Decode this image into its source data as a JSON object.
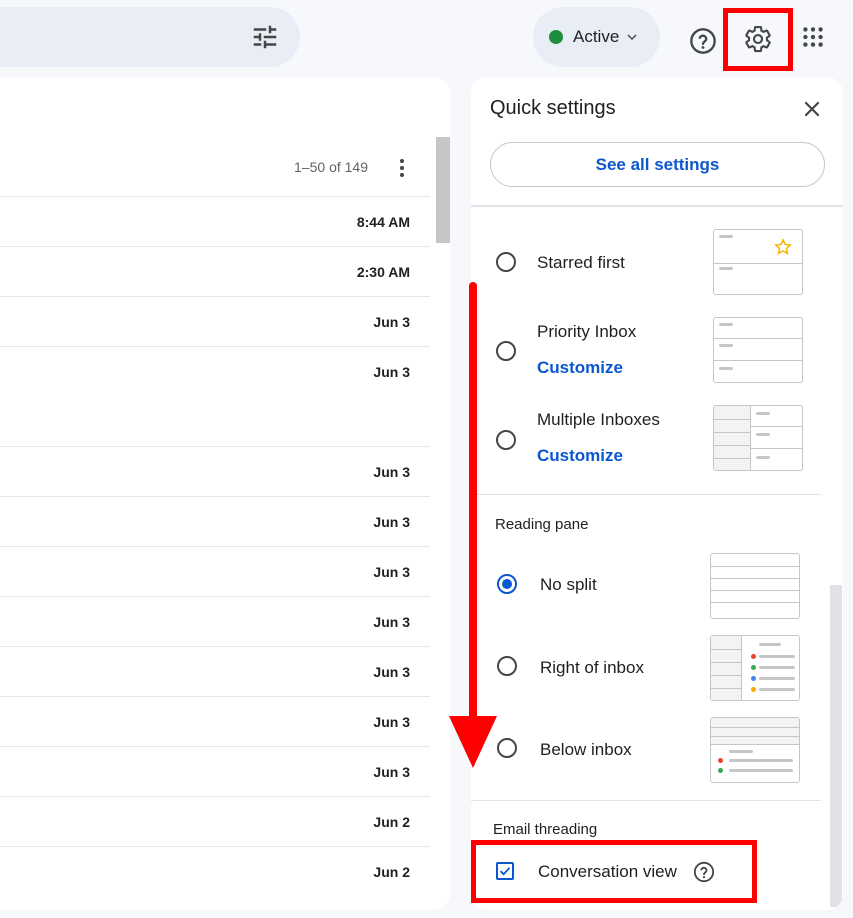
{
  "topbar": {
    "status_label": "Active",
    "status_color": "#1e8e3e"
  },
  "list": {
    "pager": "1–50 of 149",
    "rows": [
      {
        "date": "8:44 AM"
      },
      {
        "date": "2:30 AM"
      },
      {
        "date": "Jun 3"
      },
      {
        "date": "Jun 3"
      },
      {
        "date": "Jun 3"
      },
      {
        "date": "Jun 3"
      },
      {
        "date": "Jun 3"
      },
      {
        "date": "Jun 3"
      },
      {
        "date": "Jun 3"
      },
      {
        "date": "Jun 3"
      },
      {
        "date": "Jun 3"
      },
      {
        "date": "Jun 2"
      },
      {
        "date": "Jun 2"
      }
    ]
  },
  "quick_settings": {
    "title": "Quick settings",
    "see_all": "See all settings",
    "inbox_types": [
      {
        "label": "Starred first",
        "customize": ""
      },
      {
        "label": "Priority Inbox",
        "customize": "Customize"
      },
      {
        "label": "Multiple Inboxes",
        "customize": "Customize"
      }
    ],
    "reading_pane": {
      "heading": "Reading pane",
      "options": [
        {
          "label": "No split",
          "selected": true
        },
        {
          "label": "Right of inbox",
          "selected": false
        },
        {
          "label": "Below inbox",
          "selected": false
        }
      ]
    },
    "threading": {
      "heading": "Email threading",
      "conversation_view": "Conversation view",
      "checked": true
    }
  },
  "colors": {
    "accent": "#0b57d0",
    "highlight": "#ff0000"
  }
}
